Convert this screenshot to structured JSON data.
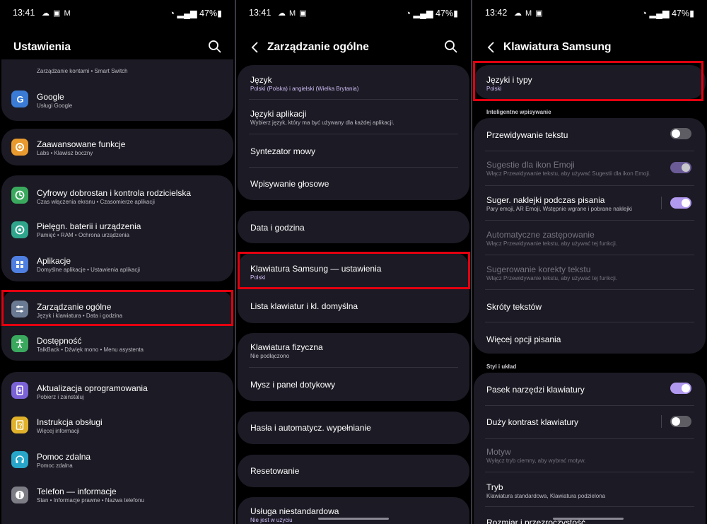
{
  "status_bars": [
    {
      "time": "13:41",
      "battery": "47%"
    },
    {
      "time": "13:41",
      "battery": "47%"
    },
    {
      "time": "13:42",
      "battery": "47%"
    }
  ],
  "panel1": {
    "title": "Ustawienia",
    "items": [
      {
        "title": "",
        "sub": "Zarządzanie kontami  •  Smart Switch",
        "icon": "account-icon",
        "color": "#3a7bd5"
      },
      {
        "title": "Google",
        "sub": "Usługi Google",
        "icon": "google-icon",
        "color": "#3a7bd5"
      },
      {
        "title": "Zaawansowane funkcje",
        "sub": "Labs  •  Klawisz boczny",
        "icon": "gear-plus-icon",
        "color": "#e89a2e"
      },
      {
        "title": "Cyfrowy dobrostan i kontrola rodzicielska",
        "sub": "Czas włączenia ekranu  •  Czasomierze aplikacji",
        "icon": "wellbeing-icon",
        "color": "#3aa95e"
      },
      {
        "title": "Pielęgn. baterii i urządzenia",
        "sub": "Pamięć  •  RAM  •  Ochrona urządzenia",
        "icon": "device-care-icon",
        "color": "#2fa58c"
      },
      {
        "title": "Aplikacje",
        "sub": "Domyślne aplikacje  •  Ustawienia aplikacji",
        "icon": "apps-icon",
        "color": "#4f7fe0"
      },
      {
        "title": "Zarządzanie ogólne",
        "sub": "Język i klawiatura  •  Data i godzina",
        "icon": "sliders-icon",
        "color": "#6a7a93"
      },
      {
        "title": "Dostępność",
        "sub": "TalkBack  •  Dźwięk mono  •  Menu asystenta",
        "icon": "accessibility-icon",
        "color": "#3aa95e"
      },
      {
        "title": "Aktualizacja oprogramowania",
        "sub": "Pobierz i zainstaluj",
        "icon": "update-icon",
        "color": "#7b62d6"
      },
      {
        "title": "Instrukcja obsługi",
        "sub": "Więcej informacji",
        "icon": "manual-icon",
        "color": "#e0b12b"
      },
      {
        "title": "Pomoc zdalna",
        "sub": "Pomoc zdalna",
        "icon": "headset-icon",
        "color": "#27a6c9"
      },
      {
        "title": "Telefon — informacje",
        "sub": "Stan  •  Informacje prawne  •  Nazwa telefonu",
        "icon": "info-icon",
        "color": "#7d7d86"
      }
    ]
  },
  "panel2": {
    "title": "Zarządzanie ogólne",
    "items": [
      {
        "title": "Język",
        "sub": "Polski (Polska) i angielski (Wielka Brytania)"
      },
      {
        "title": "Języki aplikacji",
        "sub": "Wybierz język, który ma być używany dla każdej aplikacji."
      },
      {
        "title": "Syntezator mowy",
        "sub": ""
      },
      {
        "title": "Wpisywanie głosowe",
        "sub": ""
      },
      {
        "title": "Data i godzina",
        "sub": ""
      },
      {
        "title": "Klawiatura Samsung — ustawienia",
        "sub": "Polski"
      },
      {
        "title": "Lista klawiatur i kl. domyślna",
        "sub": ""
      },
      {
        "title": "Klawiatura fizyczna",
        "sub": "Nie podłączono"
      },
      {
        "title": "Mysz i panel dotykowy",
        "sub": ""
      },
      {
        "title": "Hasła i automatycz. wypełnianie",
        "sub": ""
      },
      {
        "title": "Resetowanie",
        "sub": ""
      },
      {
        "title": "Usługa niestandardowa",
        "sub": "Nie jest w użyciu"
      }
    ]
  },
  "panel3": {
    "title": "Klawiatura Samsung",
    "languages": {
      "title": "Języki i typy",
      "sub": "Polski"
    },
    "section1": "Inteligentne wpisywanie",
    "smart_items": [
      {
        "title": "Przewidywanie tekstu",
        "sub": "",
        "toggle": "off"
      },
      {
        "title": "Sugestie dla ikon Emoji",
        "sub": "Włącz Przewidywanie tekstu, aby używać Sugestii dla ikon Emoji.",
        "toggle": "on-dim"
      },
      {
        "title": "Suger. naklejki podczas pisania",
        "sub": "Pary emoji, AR Emoji, Wstępnie wgrane i pobrane naklejki",
        "toggle": "on"
      },
      {
        "title": "Automatyczne zastępowanie",
        "sub": "Włącz Przewidywanie tekstu, aby używać tej funkcji.",
        "toggle": ""
      },
      {
        "title": "Sugerowanie korekty tekstu",
        "sub": "Włącz Przewidywanie tekstu, aby używać tej funkcji.",
        "toggle": ""
      },
      {
        "title": "Skróty tekstów",
        "sub": "",
        "toggle": ""
      },
      {
        "title": "Więcej opcji pisania",
        "sub": "",
        "toggle": ""
      }
    ],
    "section2": "Styl i układ",
    "style_items": [
      {
        "title": "Pasek narzędzi klawiatury",
        "sub": "",
        "toggle": "on"
      },
      {
        "title": "Duży kontrast klawiatury",
        "sub": "",
        "toggle": "off"
      },
      {
        "title": "Motyw",
        "sub": "Wyłącz tryb ciemny, aby wybrać motyw.",
        "toggle": ""
      },
      {
        "title": "Tryb",
        "sub": "Klawiatura standardowa, Klawiatura podzielona",
        "toggle": ""
      },
      {
        "title": "Rozmiar i przezroczystość",
        "sub": "",
        "toggle": ""
      }
    ]
  },
  "colors": {
    "highlight": "#e3000f",
    "accent": "#b199f0",
    "card": "#1c1a24"
  }
}
